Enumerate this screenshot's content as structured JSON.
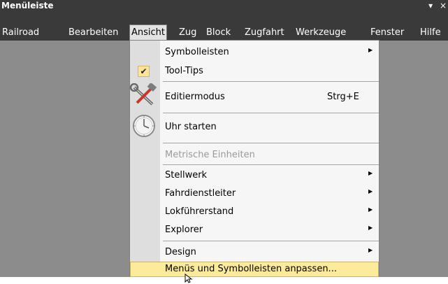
{
  "window": {
    "title": "Menüleiste",
    "controls": [
      "▾",
      "×"
    ]
  },
  "menubar": {
    "items": [
      {
        "label": "Railroad",
        "active": false
      },
      {
        "label": "Bearbeiten",
        "active": false
      },
      {
        "label": "Ansicht",
        "active": true
      },
      {
        "label": "Zug",
        "active": false
      },
      {
        "label": "Block",
        "active": false
      },
      {
        "label": "Zugfahrt",
        "active": false
      },
      {
        "label": "Werkzeuge",
        "active": false
      },
      {
        "label": "Fenster",
        "active": false
      },
      {
        "label": "Hilfe",
        "active": false
      }
    ]
  },
  "popup": {
    "items": [
      {
        "label": "Symbolleisten",
        "submenu": true
      },
      {
        "label": "Tool-Tips",
        "checked": true
      },
      {
        "label": "Editiermodus",
        "shortcut": "Strg+E",
        "icon": "tools-icon"
      },
      {
        "label": "Uhr starten",
        "icon": "clock-icon"
      },
      {
        "label": "Metrische Einheiten",
        "disabled": true
      },
      {
        "label": "Stellwerk",
        "submenu": true
      },
      {
        "label": "Fahrdienstleiter",
        "submenu": true
      },
      {
        "label": "Lokführerstand",
        "submenu": true
      },
      {
        "label": "Explorer",
        "submenu": true
      },
      {
        "label": "Design",
        "submenu": true
      },
      {
        "label": "Menüs und Symbolleisten anpassen...",
        "highlighted": true
      }
    ],
    "arrow_glyph": "▶",
    "check_glyph": "✔"
  },
  "colors": {
    "chrome": "#3a3a3a",
    "workspace": "#8c8c8c",
    "menu_bg": "#f6f6f6",
    "gutter": "#dedede",
    "highlight": "#fdeb9c"
  }
}
